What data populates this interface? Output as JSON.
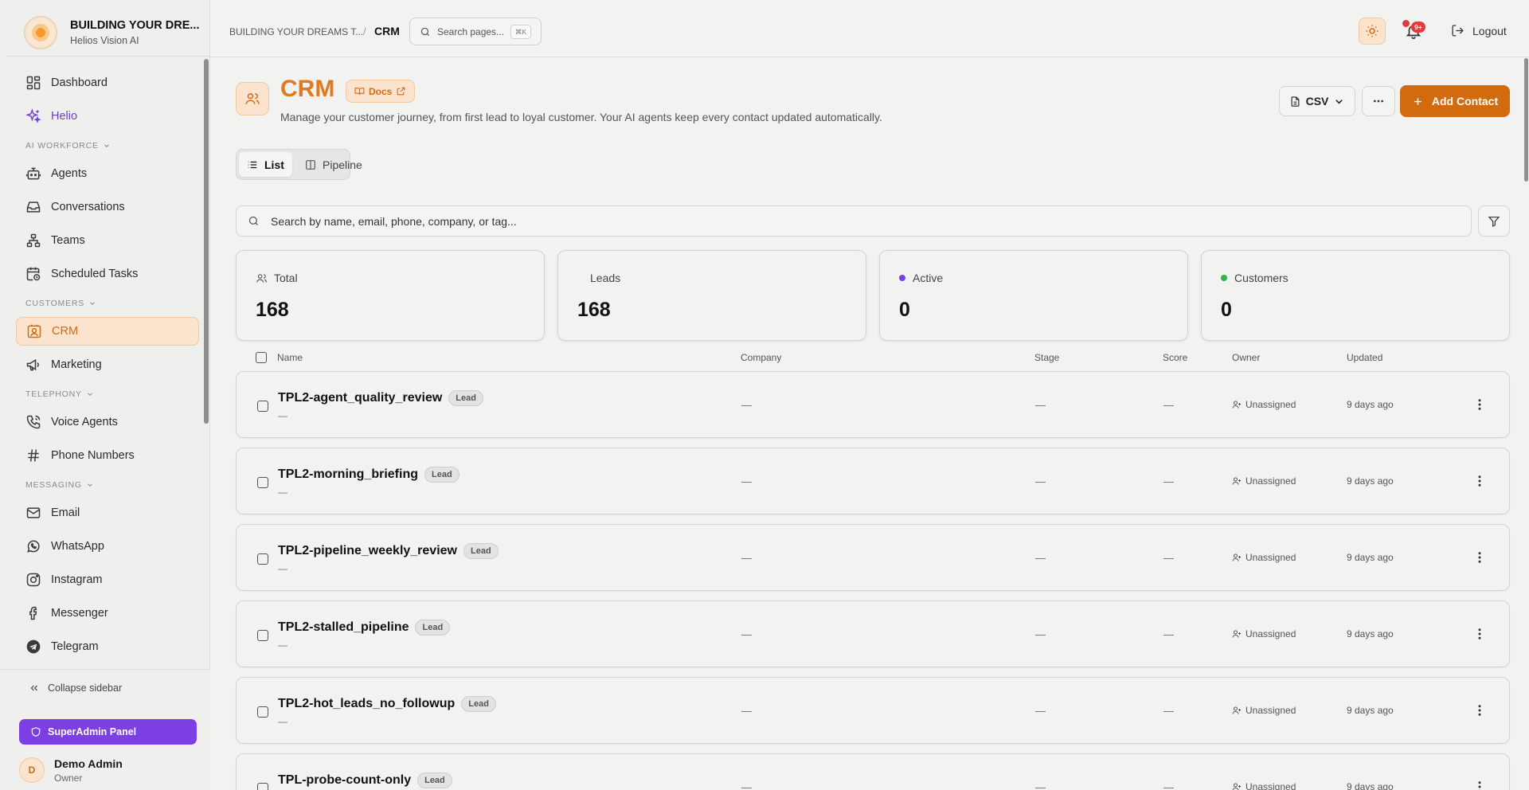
{
  "brand": {
    "title": "BUILDING YOUR DRE...",
    "subtitle": "Helios Vision AI"
  },
  "sidebar": {
    "top_items": [
      {
        "label": "Dashboard",
        "icon": "dashboard-icon"
      },
      {
        "label": "Helio",
        "icon": "sparkles-icon"
      }
    ],
    "sections": [
      {
        "label": "AI WORKFORCE",
        "items": [
          "Agents",
          "Conversations",
          "Teams",
          "Scheduled Tasks"
        ]
      },
      {
        "label": "CUSTOMERS",
        "items": [
          "CRM",
          "Marketing"
        ]
      },
      {
        "label": "TELEPHONY",
        "items": [
          "Voice Agents",
          "Phone Numbers"
        ]
      },
      {
        "label": "MESSAGING",
        "items": [
          "Email",
          "WhatsApp",
          "Instagram",
          "Messenger",
          "Telegram"
        ]
      }
    ],
    "active_item": "CRM",
    "collapse_label": "Collapse sidebar",
    "superadmin_label": "SuperAdmin Panel",
    "user": {
      "initial": "D",
      "name": "Demo Admin",
      "role": "Owner"
    }
  },
  "header": {
    "breadcrumb_root": "BUILDING YOUR DREAMS T...",
    "breadcrumb_sep": "/",
    "breadcrumb_current": "CRM",
    "search_placeholder": "Search pages...",
    "search_shortcut": "⌘K",
    "notification_badge": "9+",
    "logout_label": "Logout"
  },
  "page": {
    "title": "CRM",
    "docs_label": "Docs",
    "description": "Manage your customer journey, from first lead to loyal customer. Your AI agents keep every contact updated automatically.",
    "csv_label": "CSV",
    "add_contact_label": "Add Contact",
    "view_list_label": "List",
    "view_pipeline_label": "Pipeline",
    "search_placeholder": "Search by name, email, phone, company, or tag..."
  },
  "stats": [
    {
      "label": "Total",
      "value": "168",
      "marker": "users-icon"
    },
    {
      "label": "Leads",
      "value": "168",
      "marker": "none"
    },
    {
      "label": "Active",
      "value": "0",
      "marker": "dot",
      "color": "#7b3fe4"
    },
    {
      "label": "Customers",
      "value": "0",
      "marker": "dot",
      "color": "#2db24c"
    }
  ],
  "table": {
    "columns": [
      "Name",
      "Company",
      "Stage",
      "Score",
      "Owner",
      "Updated"
    ],
    "rows": [
      {
        "name": "TPL2-agent_quality_review",
        "tag": "Lead",
        "sub": "—",
        "company": "—",
        "stage": "—",
        "score": "—",
        "owner": "Unassigned",
        "updated": "9 days ago"
      },
      {
        "name": "TPL2-morning_briefing",
        "tag": "Lead",
        "sub": "—",
        "company": "—",
        "stage": "—",
        "score": "—",
        "owner": "Unassigned",
        "updated": "9 days ago"
      },
      {
        "name": "TPL2-pipeline_weekly_review",
        "tag": "Lead",
        "sub": "—",
        "company": "—",
        "stage": "—",
        "score": "—",
        "owner": "Unassigned",
        "updated": "9 days ago"
      },
      {
        "name": "TPL2-stalled_pipeline",
        "tag": "Lead",
        "sub": "—",
        "company": "—",
        "stage": "—",
        "score": "—",
        "owner": "Unassigned",
        "updated": "9 days ago"
      },
      {
        "name": "TPL2-hot_leads_no_followup",
        "tag": "Lead",
        "sub": "—",
        "company": "—",
        "stage": "—",
        "score": "—",
        "owner": "Unassigned",
        "updated": "9 days ago"
      },
      {
        "name": "TPL-probe-count-only",
        "tag": "Lead",
        "sub": "—",
        "company": "—",
        "stage": "—",
        "score": "—",
        "owner": "Unassigned",
        "updated": "9 days ago"
      }
    ]
  },
  "colors": {
    "accent": "#d26a0f",
    "accent_light": "#fbe3cd",
    "purple": "#7b3fe4",
    "badge_red": "#e5393b"
  }
}
